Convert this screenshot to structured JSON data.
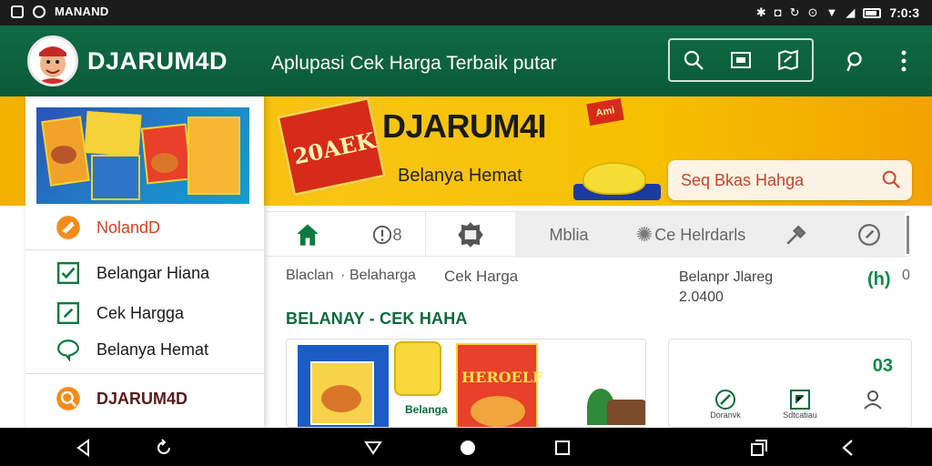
{
  "status_bar": {
    "carrier": "MANAND",
    "time": "7:0:3",
    "icons_left": [
      "message-icon",
      "notification-icon"
    ],
    "icons_right": [
      "settings-icon",
      "alarm-icon",
      "sync-icon",
      "data-icon",
      "wifi-icon",
      "signal-icon",
      "battery-icon"
    ]
  },
  "app_bar": {
    "brand": "DJARUM4D",
    "subtitle": "Aplupasi Cek Harga Terbaik putar",
    "actions": [
      "search-icon",
      "image-icon",
      "map-icon",
      "location-icon",
      "more-icon"
    ]
  },
  "banner": {
    "pack_text": "20AEK",
    "brand": "DJARUM4I",
    "tagline": "Belanya Hemat",
    "search_placeholder": "Seq Bkas Hahga",
    "promo_tag": "Ami"
  },
  "drawer": {
    "items": [
      {
        "label": "NolandD",
        "icon": "nolan-icon"
      },
      {
        "label": "Belangar Hiana",
        "icon": "check-icon"
      },
      {
        "label": "Cek Hargga",
        "icon": "pencil-icon"
      },
      {
        "label": "Belanya Hemat",
        "icon": "chat-icon"
      },
      {
        "label": "DJARUM4D",
        "icon": "brand-icon"
      }
    ]
  },
  "tabs": [
    {
      "label": "",
      "icon": "home-icon"
    },
    {
      "label": "8",
      "icon": "info-icon"
    },
    {
      "label": "",
      "icon": "badge-icon"
    },
    {
      "label": "Mblia",
      "icon": ""
    },
    {
      "label": "Ce Helrdarls",
      "icon": "sun-icon"
    },
    {
      "label": "",
      "icon": "tool-icon"
    },
    {
      "label": "",
      "icon": "compass-icon"
    }
  ],
  "main": {
    "breadcrumb": [
      "Blaclan",
      "Belaharga",
      "Cek Harga"
    ],
    "section_title": "BELANAY - CEK HAHA",
    "price_label": "Belanpr Jlareg",
    "price_value": "2.0400",
    "badge": "(h)",
    "badge_count": "0",
    "product_caption": "Belanga",
    "product_title": "HEROELF",
    "action_count": "03",
    "actions": [
      {
        "label": "Doranvk",
        "icon": "pen-icon"
      },
      {
        "label": "Sdtcatiau",
        "icon": "resize-icon"
      },
      {
        "label": "",
        "icon": "user-icon"
      }
    ]
  },
  "nav_bar": [
    "back-icon",
    "refresh-icon",
    "down-icon",
    "home-dot-icon",
    "recents-icon",
    "copy-icon",
    "back-arrow-icon"
  ],
  "colors": {
    "primary": "#0b6b44",
    "accent": "#f5b800",
    "orange": "#f18a1c",
    "green_text": "#0b6b3c"
  }
}
